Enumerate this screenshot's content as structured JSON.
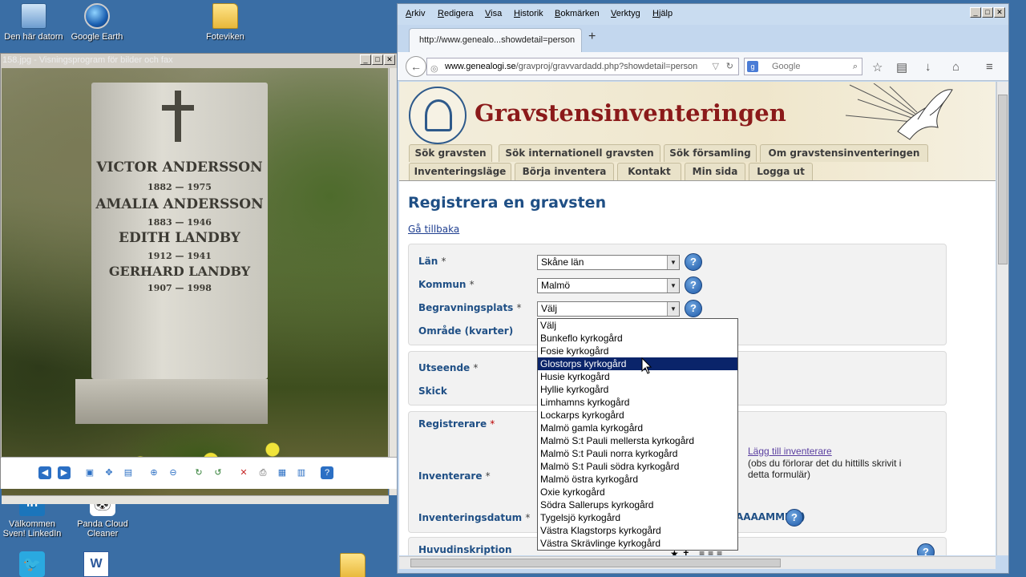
{
  "desktop": {
    "icons": [
      {
        "label": "Den här datorn"
      },
      {
        "label": "Google Earth"
      },
      {
        "label": "Foteviken"
      },
      {
        "label": "Välkommen Sven!  LinkedIn"
      },
      {
        "label": "Panda Cloud Cleaner"
      }
    ]
  },
  "viewer": {
    "title": "158.jpg - Visningsprogram för bilder och fax",
    "inscription": [
      "VICTOR ANDERSSON",
      "1882 — 1975",
      "AMALIA ANDERSSON",
      "1883 — 1946",
      "EDITH LANDBY",
      "1912 — 1941",
      "GERHARD LANDBY",
      "1907 — 1998"
    ]
  },
  "browser": {
    "menu": [
      "Arkiv",
      "Redigera",
      "Visa",
      "Historik",
      "Bokmärken",
      "Verktyg",
      "Hjälp"
    ],
    "tab_title": "http://www.genealo...showdetail=person",
    "url_host": "www.genealogi.se",
    "url_path": "/gravproj/gravvardadd.php?showdetail=person",
    "search_placeholder": "Google"
  },
  "site": {
    "title": "Gravstensinventeringen",
    "nav_row1": [
      "Sök gravsten",
      "Sök internationell gravsten",
      "Sök församling",
      "Om gravstensinventeringen"
    ],
    "nav_row2": [
      "Inventeringsläge",
      "Börja inventera",
      "Kontakt",
      "Min sida",
      "Logga ut"
    ]
  },
  "form": {
    "heading": "Registrera en gravsten",
    "back_link": "Gå tillbaka",
    "lan_label": "Län",
    "lan_value": "Skåne län",
    "kommun_label": "Kommun",
    "kommun_value": "Malmö",
    "begravningsplats_label": "Begravningsplats",
    "begravningsplats_value": "Välj",
    "omrade_label": "Område (kvarter)",
    "utseende_label": "Utseende",
    "skick_label": "Skick",
    "registrerare_label": "Registrerare",
    "inventerare_label": "Inventerare",
    "add_inventerare_link": "Lägg till inventerare",
    "add_inventerare_note": "(obs du förlorar det du hittills skrivit i detta formulär)",
    "inventeringsdatum_label": "Inventeringsdatum",
    "date_format_hint": "AAAAMMDD)",
    "huvudinskription_label": "Huvudinskription",
    "required_mark": "*",
    "help_glyph": "?",
    "dropdown_options": [
      "Välj",
      "Bunkeflo kyrkogård",
      "Fosie kyrkogård",
      "Glostorps kyrkogård",
      "Husie kyrkogård",
      "Hyllie kyrkogård",
      "Limhamns kyrkogård",
      "Lockarps kyrkogård",
      "Malmö gamla kyrkogård",
      "Malmö S:t Pauli mellersta kyrkogård",
      "Malmö S:t Pauli norra kyrkogård",
      "Malmö S:t Pauli södra kyrkogård",
      "Malmö östra kyrkogård",
      "Oxie kyrkogård",
      "Södra Sallerups kyrkogård",
      "Tygelsjö kyrkogård",
      "Västra Klagstorps kyrkogård",
      "Västra Skrävlinge kyrkogård"
    ],
    "highlighted_option": "Glostorps kyrkogård"
  }
}
